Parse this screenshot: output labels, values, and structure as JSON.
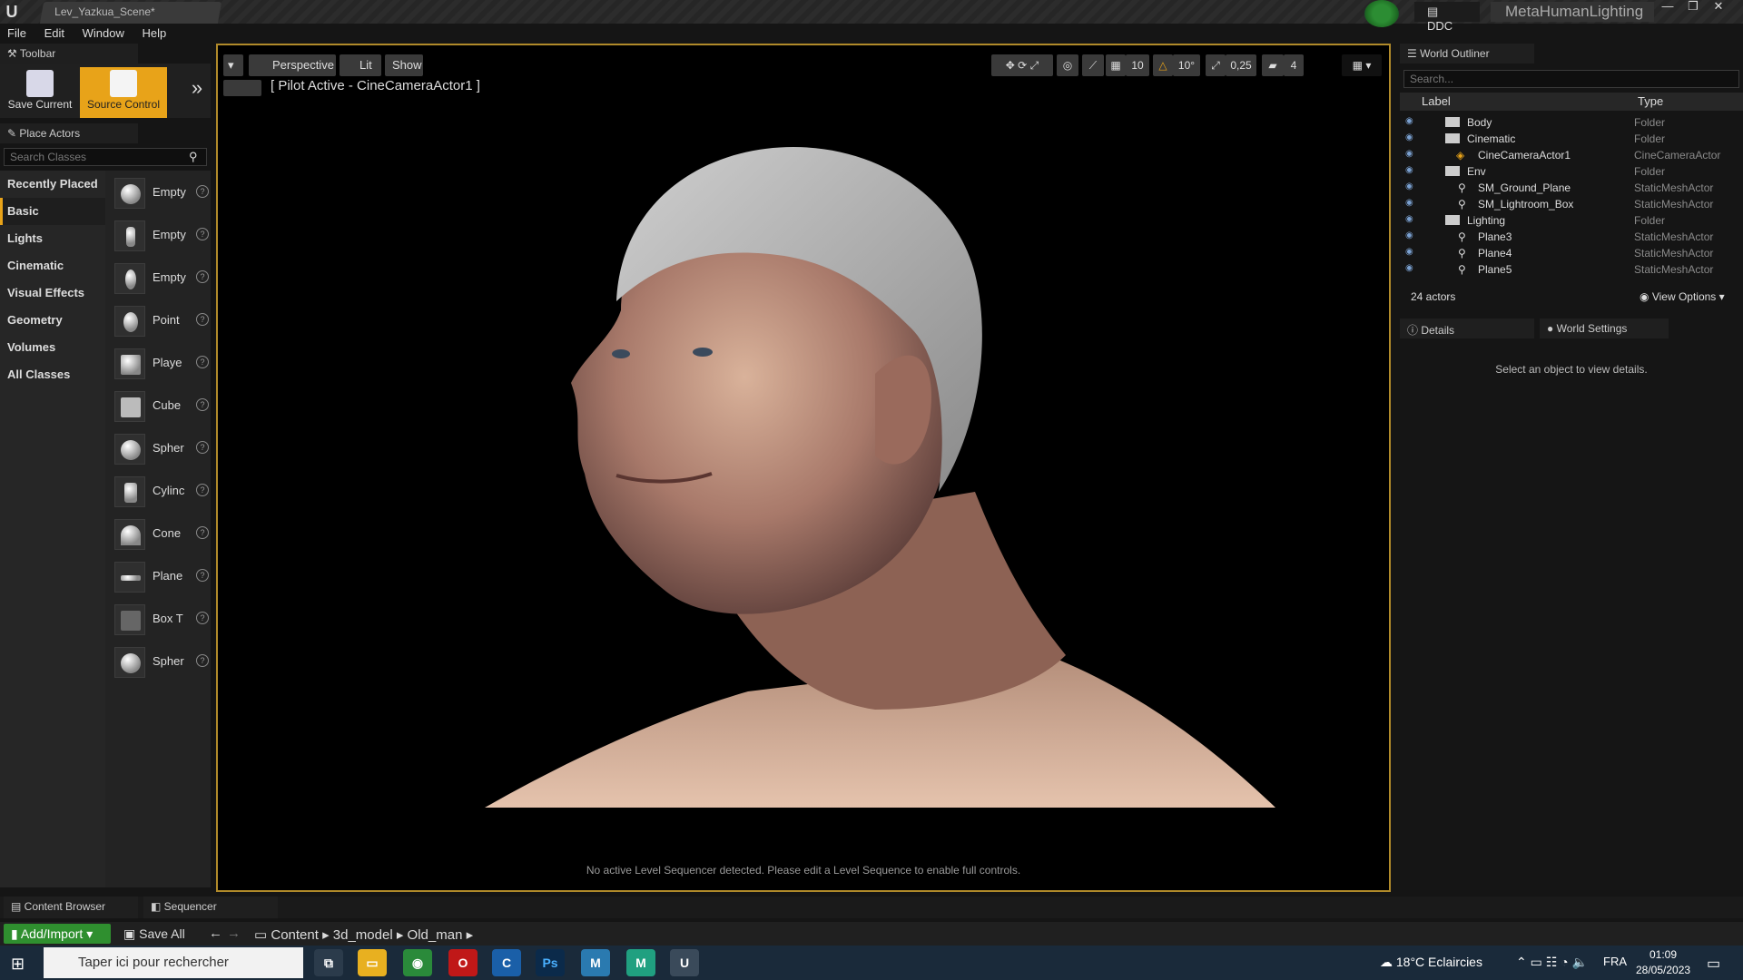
{
  "window": {
    "tab_title": "Lev_Yazkua_Scene*",
    "ddc_label": "DDC",
    "project_name": "MetaHumanLighting"
  },
  "menu": [
    "File",
    "Edit",
    "Window",
    "Help"
  ],
  "toolbar": {
    "tab_label": "Toolbar",
    "save_current": "Save Current",
    "source_control": "Source Control"
  },
  "place_actors": {
    "tab_label": "Place Actors",
    "search_placeholder": "Search Classes",
    "categories": [
      "Recently Placed",
      "Basic",
      "Lights",
      "Cinematic",
      "Visual Effects",
      "Geometry",
      "Volumes",
      "All Classes"
    ],
    "active_category": "Basic",
    "actors": [
      "Empty",
      "Empty",
      "Empty",
      "Point",
      "Playe",
      "Cube",
      "Spher",
      "Cylinc",
      "Cone",
      "Plane",
      "Box T",
      "Spher"
    ]
  },
  "viewport": {
    "perspective_label": "Perspective",
    "lit_label": "Lit",
    "show_label": "Show",
    "grid_snap": "10",
    "rotation_snap": "10°",
    "scale_snap": "0,25",
    "camera_speed": "4",
    "pilot_text": "[ Pilot Active - CineCameraActor1 ]",
    "sequencer_message": "No active Level Sequencer detected. Please edit a Level Sequence to enable full controls."
  },
  "outliner": {
    "tab_label": "World Outliner",
    "search_placeholder": "Search...",
    "col_label": "Label",
    "col_type": "Type",
    "rows": [
      {
        "label": "Body",
        "type": "Folder"
      },
      {
        "label": "Cinematic",
        "type": "Folder"
      },
      {
        "label": "CineCameraActor1",
        "type": "CineCameraActor"
      },
      {
        "label": "Env",
        "type": "Folder"
      },
      {
        "label": "SM_Ground_Plane",
        "type": "StaticMeshActor"
      },
      {
        "label": "SM_Lightroom_Box",
        "type": "StaticMeshActor"
      },
      {
        "label": "Lighting",
        "type": "Folder"
      },
      {
        "label": "Plane3",
        "type": "StaticMeshActor"
      },
      {
        "label": "Plane4",
        "type": "StaticMeshActor"
      },
      {
        "label": "Plane5",
        "type": "StaticMeshActor"
      }
    ],
    "actors_count": "24 actors",
    "view_options": "View Options"
  },
  "details": {
    "tab_label": "Details",
    "world_settings_label": "World Settings",
    "message": "Select an object to view details."
  },
  "bottom": {
    "content_browser": "Content Browser",
    "sequencer": "Sequencer",
    "add_import": "Add/Import",
    "save_all": "Save All",
    "path": [
      "Content",
      "3d_model",
      "Old_man"
    ]
  },
  "taskbar": {
    "search_placeholder": "Taper ici pour rechercher",
    "weather": "18°C  Eclaircies",
    "language": "FRA",
    "time": "01:09",
    "date": "28/05/2023"
  },
  "colors": {
    "accent": "#e8a319",
    "viewport_border": "#b08a2a",
    "add_button": "#2f8f2f"
  }
}
